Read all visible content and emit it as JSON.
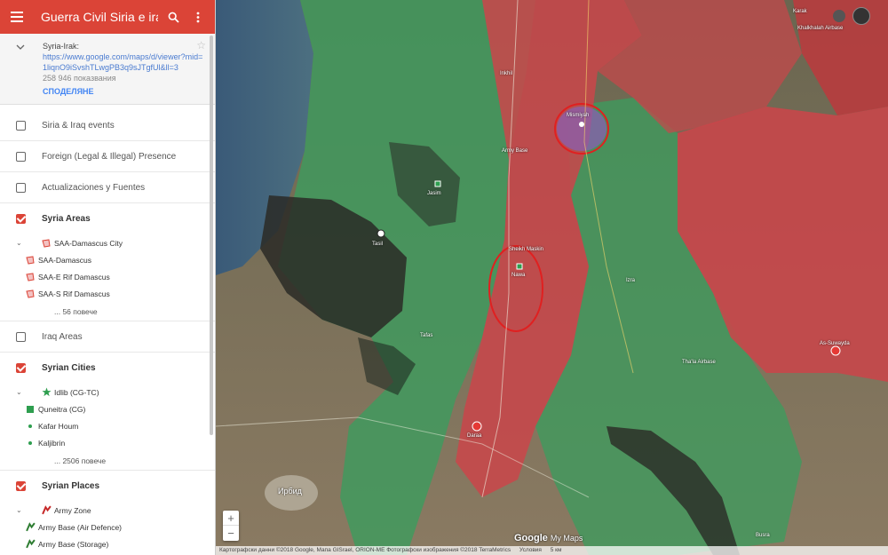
{
  "header": {
    "title": "Guerra Civil Siria e irak"
  },
  "map_info": {
    "name": "Syria-Irak:",
    "url": "https://www.google.com/maps/d/viewer?mid=1liqnO9iSvshTLwgPB3q9sJTgfUl&ll=3",
    "views": "258 946 показвания",
    "share_label": "СПОДЕЛЯНЕ"
  },
  "layers": {
    "siria_iraq_events": "Siria & Iraq events",
    "foreign_presence": "Foreign (Legal & Illegal) Presence",
    "actualizaciones": "Actualizaciones y Fuentes",
    "syria_areas": {
      "label": "Syria Areas",
      "items": [
        "SAA-Damascus City",
        "SAA-Damascus",
        "SAA-E Rif Damascus",
        "SAA-S Rif Damascus"
      ],
      "more": "... 56 повече"
    },
    "iraq_areas": "Iraq Areas",
    "syrian_cities": {
      "label": "Syrian Cities",
      "items": [
        "Idlib (CG-TC)",
        "Quneitra (CG)",
        "Kafar Houm",
        "Kaljibrin"
      ],
      "more": "... 2506 повече"
    },
    "syrian_places": {
      "label": "Syrian Places",
      "items": [
        "Army Zone",
        "Army Base (Air Defence)",
        "Army Base (Storage)"
      ]
    }
  },
  "map": {
    "labels": {
      "karak": "Karak",
      "as_suwayda": "As-Suwayda",
      "nawa": "Nawa",
      "daraa": "Daraa",
      "irbid": "Ирбид",
      "mismiyah": "Mismiyah",
      "khalkhalah": "Khalkhalah Airbase",
      "thaala": "Tha'la Airbase",
      "army_base": "Army Base",
      "jasim": "Jasim",
      "inkhil": "Inkhil",
      "sheikh_maskin": "Sheikh Maskin",
      "izra": "Izra",
      "busra": "Busra",
      "tafas": "Tafas",
      "tasil": "Tasil"
    },
    "zoom_in": "+",
    "zoom_out": "−",
    "google_logo": "Google",
    "my_maps": "My Maps",
    "attribution": "Картографски данни ©2018 Google, Мапа GISrael, ORION-ME Фотографски изображения ©2018 TerraMetrics",
    "terms": "Условия",
    "scale": "5 км"
  },
  "colors": {
    "accent": "#db4437",
    "saa_area": "#c9464a",
    "rebel_area": "#3e9b5e",
    "isis_area": "#2a2a26"
  }
}
